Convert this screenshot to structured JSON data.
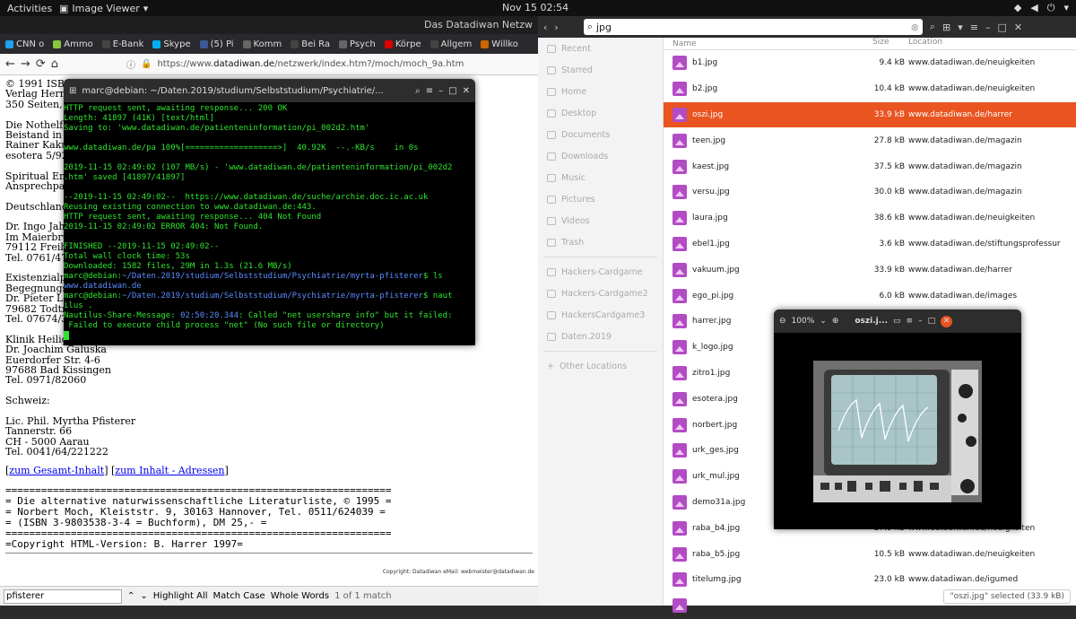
{
  "topbar": {
    "activities": "Activities",
    "app": "Image Viewer",
    "clock": "Nov 15  02:54"
  },
  "firefox": {
    "window_title": "Das Datadiwan Netzw",
    "tabs": [
      {
        "label": "CNN o",
        "color": "#1da1f2"
      },
      {
        "label": "Ammo",
        "color": "#8cc63f"
      },
      {
        "label": "E-Bank",
        "color": "#444"
      },
      {
        "label": "Skype",
        "color": "#00aff0"
      },
      {
        "label": "(5) Pi",
        "color": "#3b5998"
      },
      {
        "label": "Komm",
        "color": "#666"
      },
      {
        "label": "Bei Ra",
        "color": "#444"
      },
      {
        "label": "Psych",
        "color": "#666"
      },
      {
        "label": "Körpe",
        "color": "#d00"
      },
      {
        "label": "Allgem",
        "color": "#444"
      },
      {
        "label": "Willko",
        "color": "#c60"
      }
    ],
    "url_prefix": "https://www.",
    "url_domain": "datadiwan.de",
    "url_path": "/netzwerk/index.htm?/moch/moch_9a.htm",
    "page_lines": [
      "© 1991 ISBN",
      "Verlag Herm",
      "350 Seiten, k",
      "",
      "Die Nothelfe",
      "Beistand in s",
      "Rainer Kaku",
      "esotera 5/92,",
      "",
      "Spiritual Em",
      "Ansprechpart",
      "",
      "Deutschland:",
      "",
      "Dr. Ingo Jahr",
      "Im Maierbrü",
      "79112 Freibu",
      "Tel. 0761/473",
      "",
      "Existenzialps",
      "Begegnungs",
      "Dr. Pieter Lo",
      "79682 Todtm",
      "Tel. 07674/3",
      "",
      "Klinik Heilige",
      "Dr. Joachim Galuska",
      "Euerdorfer Str. 4-6",
      "97688 Bad Kissingen",
      "Tel. 0971/82060",
      "",
      "Schweiz:",
      "",
      "Lic. Phil. Myrtha Pfisterer",
      "Tannerstr. 66",
      "CH - 5000 Aarau",
      "Tel. 0041/64/221222"
    ],
    "link1": "zum Gesamt-Inhalt",
    "link2": "zum Inhalt - Adressen",
    "banner": [
      "=================================================================",
      "= Die alternative naturwissenschaftliche Literaturliste, © 1995 =",
      "= Norbert Moch, Kleiststr. 9, 30163 Hannover, Tel. 0511/624039 =",
      "= (ISBN 3-9803538-3-4 = Buchform), DM 25,- =",
      "=================================================================",
      "=Copyright HTML-Version: B. Harrer 1997="
    ],
    "footer": "Copyright: Datadiwan eMail: webmeister@datadiwan.de",
    "find": {
      "value": "pfisterer",
      "highlight": "Highlight All",
      "match_case": "Match Case",
      "whole_words": "Whole Words",
      "result": "1 of 1 match"
    }
  },
  "terminal": {
    "title": "marc@debian: ~/Daten.2019/studium/Selbststudium/Psychiatrie/...",
    "lines": [
      "HTTP request sent, awaiting response... 200 OK",
      "Length: 41897 (41K) [text/html]",
      "Saving to: 'www.datadiwan.de/patienteninformation/pi_002d2.htm'",
      "",
      "www.datadiwan.de/pa 100%[===================>]  40.92K  --.-KB/s    in 0s",
      "",
      "2019-11-15 02:49:02 (107 MB/s) - 'www.datadiwan.de/patienteninformation/pi_002d2",
      ".htm' saved [41897/41897]",
      "",
      "--2019-11-15 02:49:02--  https://www.datadiwan.de/suche/archie.doc.ic.ac.uk",
      "Reusing existing connection to www.datadiwan.de:443.",
      "HTTP request sent, awaiting response... 404 Not Found",
      "2019-11-15 02:49:02 ERROR 404: Not Found.",
      "",
      "FINISHED --2019-11-15 02:49:02--",
      "Total wall clock time: 53s",
      "Downloaded: 1582 files, 29M in 1.3s (21.6 MB/s)"
    ],
    "prompt1_user": "marc@debian:",
    "prompt1_path": "~/Daten.2019/studium/Selbststudium/Psychiatrie/myrta-pfisterer",
    "prompt1_cmd": "$ ls",
    "ls_out": "www.datadiwan.de",
    "prompt2_user": "marc@debian:",
    "prompt2_path": "~/Daten.2019/studium/Selbststudium/Psychiatrie/myrta-pfisterer",
    "prompt2_cmd": "$ naut",
    "prompt2_wrap": "ilus .",
    "msg_prefix": "Nautilus-Share-Message: ",
    "msg_time": "02:50:20.344",
    "msg_text": ": Called \"net usershare info\" but it failed:",
    "msg_text2": " Failed to execute child process \"net\" (No such file or directory)"
  },
  "nautilus": {
    "search": "jpg",
    "sidebar": [
      "Recent",
      "Starred",
      "Home",
      "Desktop",
      "Documents",
      "Downloads",
      "Music",
      "Pictures",
      "Videos",
      "Trash"
    ],
    "bookmarks": [
      "Hackers-Cardgame",
      "Hackers-Cardgame2",
      "HackersCardgame3",
      "Daten.2019"
    ],
    "other": "Other Locations",
    "columns": {
      "name": "Name",
      "size": "Size",
      "location": "Location"
    },
    "files": [
      {
        "name": "b1.jpg",
        "size": "9.4 kB",
        "loc": "www.datadiwan.de/neuigkeiten"
      },
      {
        "name": "b2.jpg",
        "size": "10.4 kB",
        "loc": "www.datadiwan.de/neuigkeiten"
      },
      {
        "name": "oszi.jpg",
        "size": "33.9 kB",
        "loc": "www.datadiwan.de/harrer",
        "selected": true
      },
      {
        "name": "teen.jpg",
        "size": "27.8 kB",
        "loc": "www.datadiwan.de/magazin"
      },
      {
        "name": "kaest.jpg",
        "size": "37.5 kB",
        "loc": "www.datadiwan.de/magazin"
      },
      {
        "name": "versu.jpg",
        "size": "30.0 kB",
        "loc": "www.datadiwan.de/magazin"
      },
      {
        "name": "laura.jpg",
        "size": "38.6 kB",
        "loc": "www.datadiwan.de/neuigkeiten"
      },
      {
        "name": "ebel1.jpg",
        "size": "3.6 kB",
        "loc": "www.datadiwan.de/stiftungsprofessur"
      },
      {
        "name": "vakuum.jpg",
        "size": "33.9 kB",
        "loc": "www.datadiwan.de/harrer"
      },
      {
        "name": "ego_pi.jpg",
        "size": "6.0 kB",
        "loc": "www.datadiwan.de/images"
      },
      {
        "name": "harrer.jpg",
        "size": "",
        "loc": ""
      },
      {
        "name": "k_logo.jpg",
        "size": "",
        "loc": ""
      },
      {
        "name": "zitro1.jpg",
        "size": "",
        "loc": ""
      },
      {
        "name": "esotera.jpg",
        "size": "",
        "loc": ""
      },
      {
        "name": "norbert.jpg",
        "size": "",
        "loc": ""
      },
      {
        "name": "urk_ges.jpg",
        "size": "",
        "loc": ""
      },
      {
        "name": "urk_mul.jpg",
        "size": "",
        "loc": ""
      },
      {
        "name": "demo31a.jpg",
        "size": "",
        "loc": ""
      },
      {
        "name": "raba_b4.jpg",
        "size": "27.9 kB",
        "loc": "www.datadiwan.de/neuigkeiten"
      },
      {
        "name": "raba_b5.jpg",
        "size": "10.5 kB",
        "loc": "www.datadiwan.de/neuigkeiten"
      },
      {
        "name": "titelumg.jpg",
        "size": "23.0 kB",
        "loc": "www.datadiwan.de/igumed"
      },
      {
        "name": "",
        "size": "",
        "loc": ""
      }
    ],
    "status": "\"oszi.jpg\" selected  (33.9 kB)"
  },
  "viewer": {
    "zoom": "100%",
    "title": "oszi.j..."
  }
}
